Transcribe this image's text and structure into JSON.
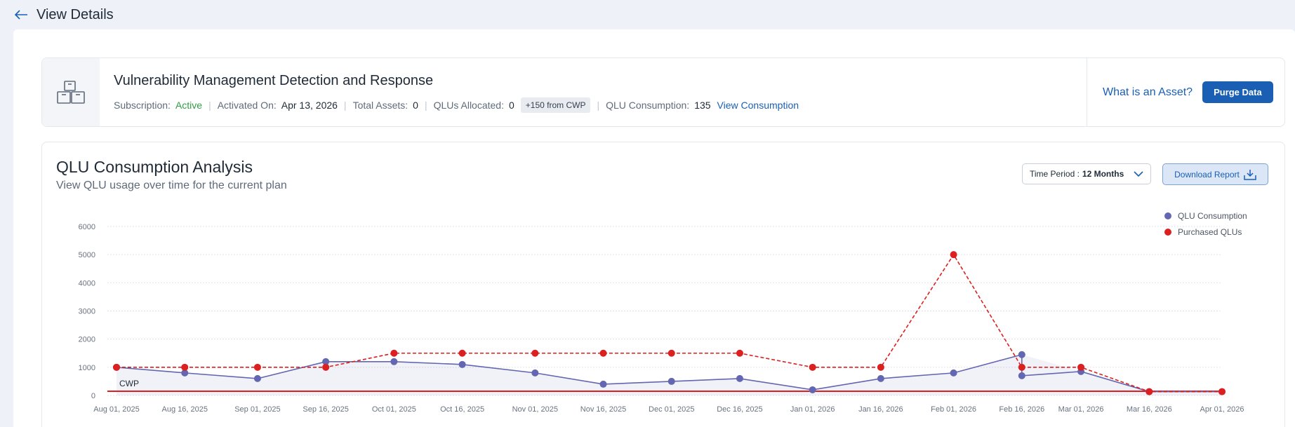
{
  "header": {
    "back_label": "View Details"
  },
  "product": {
    "title": "Vulnerability Management Detection and Response",
    "subscription_label": "Subscription",
    "subscription_value": "Active",
    "activated_label": "Activated On",
    "activated_value": "Apr 13, 2026",
    "assets_label": "Total Assets",
    "assets_value": "0",
    "qlus_allocated_label": "QLUs Allocated",
    "qlus_allocated_value": "0",
    "cwp_badge": "+150 from CWP",
    "consumption_label": "QLU Consumption",
    "consumption_value": "135",
    "view_consumption_link": "View Consumption",
    "what_is_asset_link": "What is an Asset?",
    "purge_button": "Purge Data"
  },
  "analysis": {
    "title": "QLU Consumption Analysis",
    "subtitle": "View QLU usage over time for the current plan",
    "time_period_label": "Time Period :",
    "time_period_value": "12 Months",
    "download_button": "Download Report"
  },
  "colors": {
    "accent": "#1a5fb4",
    "consumption": "#6366b0",
    "purchased": "#dc1f1f",
    "active": "#2f9e44"
  },
  "chart_data": {
    "type": "line",
    "x": [
      "Aug 01, 2025",
      "Aug 16, 2025",
      "Sep 01, 2025",
      "Sep 16, 2025",
      "Oct 01, 2025",
      "Oct 16, 2025",
      "Nov 01, 2025",
      "Nov 16, 2025",
      "Dec 01, 2025",
      "Dec 16, 2025",
      "Jan 01, 2026",
      "Jan 16, 2026",
      "Feb 01, 2026",
      "Feb 16, 2026",
      "Mar 01, 2026",
      "Mar 16, 2026",
      "Apr 01, 2026"
    ],
    "x_dates": [
      "2025-08-01",
      "2025-08-16",
      "2025-09-01",
      "2025-09-16",
      "2025-10-01",
      "2025-10-16",
      "2025-11-01",
      "2025-11-16",
      "2025-12-01",
      "2025-12-16",
      "2026-01-01",
      "2026-01-16",
      "2026-02-01",
      "2026-02-16",
      "2026-03-01",
      "2026-03-16",
      "2026-04-01"
    ],
    "yticks": [
      0,
      1000,
      2000,
      3000,
      4000,
      5000,
      6000
    ],
    "ylim": [
      0,
      6000
    ],
    "grid": true,
    "legend_position": "top-right",
    "reference_line": {
      "label": "CWP",
      "value": 150
    },
    "series": [
      {
        "name": "QLU Consumption",
        "style": "solid",
        "points": [
          {
            "x": "2025-08-01",
            "y": 1000
          },
          {
            "x": "2025-08-16",
            "y": 800
          },
          {
            "x": "2025-09-01",
            "y": 600
          },
          {
            "x": "2025-09-16",
            "y": 1200
          },
          {
            "x": "2025-10-01",
            "y": 1200
          },
          {
            "x": "2025-10-16",
            "y": 1100
          },
          {
            "x": "2025-11-01",
            "y": 800
          },
          {
            "x": "2025-11-16",
            "y": 400
          },
          {
            "x": "2025-12-01",
            "y": 500
          },
          {
            "x": "2025-12-16",
            "y": 600
          },
          {
            "x": "2026-01-01",
            "y": 200
          },
          {
            "x": "2026-01-16",
            "y": 600
          },
          {
            "x": "2026-02-01",
            "y": 800
          },
          {
            "x": "2026-02-16",
            "y": 1450
          },
          {
            "x": "2026-02-16",
            "y": 700
          },
          {
            "x": "2026-03-01",
            "y": 850
          },
          {
            "x": "2026-03-16",
            "y": 135
          },
          {
            "x": "2026-04-01",
            "y": 135
          }
        ]
      },
      {
        "name": "Purchased QLUs",
        "style": "dashed",
        "points": [
          {
            "x": "2025-08-01",
            "y": 1000
          },
          {
            "x": "2025-08-16",
            "y": 1000
          },
          {
            "x": "2025-09-01",
            "y": 1000
          },
          {
            "x": "2025-09-16",
            "y": 1000
          },
          {
            "x": "2025-10-01",
            "y": 1500
          },
          {
            "x": "2025-10-16",
            "y": 1500
          },
          {
            "x": "2025-11-01",
            "y": 1500
          },
          {
            "x": "2025-11-16",
            "y": 1500
          },
          {
            "x": "2025-12-01",
            "y": 1500
          },
          {
            "x": "2025-12-16",
            "y": 1500
          },
          {
            "x": "2026-01-01",
            "y": 1000
          },
          {
            "x": "2026-01-16",
            "y": 1000
          },
          {
            "x": "2026-02-01",
            "y": 5000
          },
          {
            "x": "2026-02-16",
            "y": 1000
          },
          {
            "x": "2026-03-01",
            "y": 1000
          },
          {
            "x": "2026-03-16",
            "y": 135
          },
          {
            "x": "2026-04-01",
            "y": 135
          }
        ]
      }
    ]
  }
}
